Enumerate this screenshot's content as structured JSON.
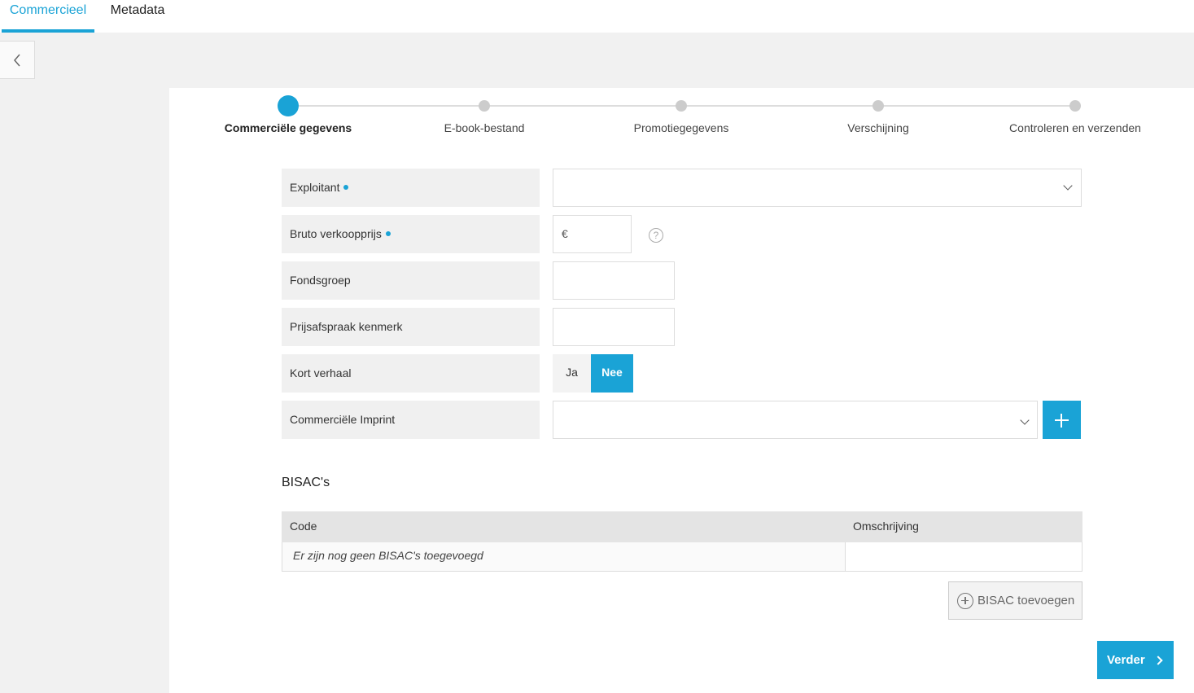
{
  "tabs": [
    {
      "label": "Commercieel",
      "active": true
    },
    {
      "label": "Metadata",
      "active": false
    }
  ],
  "stepper": {
    "steps": [
      {
        "label": "Commerciële gegevens",
        "active": true
      },
      {
        "label": "E-book-bestand",
        "active": false
      },
      {
        "label": "Promotiegegevens",
        "active": false
      },
      {
        "label": "Verschijning",
        "active": false
      },
      {
        "label": "Controleren en verzenden",
        "active": false
      }
    ]
  },
  "form": {
    "exploitant": {
      "label": "Exploitant",
      "required": true,
      "value": ""
    },
    "bruto_verkoopprijs": {
      "label": "Bruto verkoopprijs",
      "required": true,
      "currency": "€",
      "value": "",
      "help": "?"
    },
    "fondsgroep": {
      "label": "Fondsgroep",
      "value": ""
    },
    "prijsafspraak_kenmerk": {
      "label": "Prijsafspraak kenmerk",
      "value": ""
    },
    "kort_verhaal": {
      "label": "Kort verhaal",
      "option_yes": "Ja",
      "option_no": "Nee",
      "selected": "Nee"
    },
    "commerciele_imprint": {
      "label": "Commerciële Imprint",
      "value": ""
    }
  },
  "bisac": {
    "title": "BISAC's",
    "columns": [
      "Code",
      "Omschrijving"
    ],
    "empty_text": "Er zijn nog geen BISAC's toegevoegd",
    "add_label": "BISAC toevoegen"
  },
  "actions": {
    "next_label": "Verder"
  },
  "colors": {
    "accent": "#1aa3d6",
    "label_bg": "#f0f0f0",
    "page_bg": "#f1f1f1"
  }
}
